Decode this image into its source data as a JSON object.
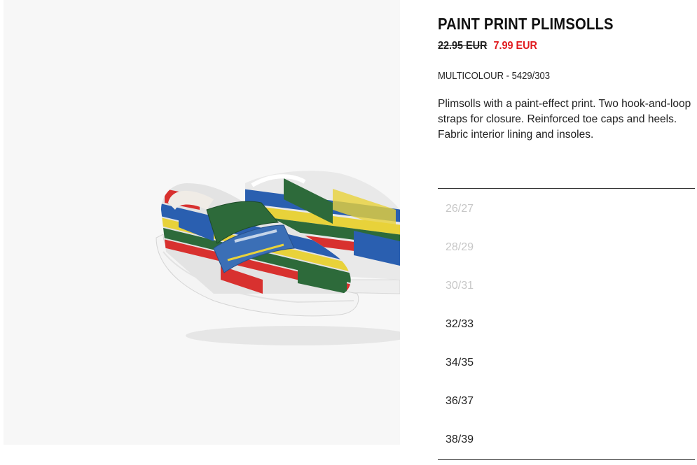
{
  "product": {
    "title": "PAINT PRINT PLIMSOLLS",
    "old_price": "22.95 EUR",
    "new_price": "7.99 EUR",
    "colour_ref": "MULTICOLOUR - 5429/303",
    "description": "Plimsolls with a paint-effect print. Two hook-and-loop straps for closure. Reinforced toe caps and heels. Fabric interior lining and insoles."
  },
  "sizes": [
    {
      "label": "26/27",
      "available": false
    },
    {
      "label": "28/29",
      "available": false
    },
    {
      "label": "30/31",
      "available": false
    },
    {
      "label": "32/33",
      "available": true
    },
    {
      "label": "34/35",
      "available": true
    },
    {
      "label": "36/37",
      "available": true
    },
    {
      "label": "38/39",
      "available": true
    }
  ],
  "colors": {
    "sale_red": "#e0191d",
    "unavailable_gray": "#c7c7c7",
    "image_background": "#f7f7f7"
  }
}
